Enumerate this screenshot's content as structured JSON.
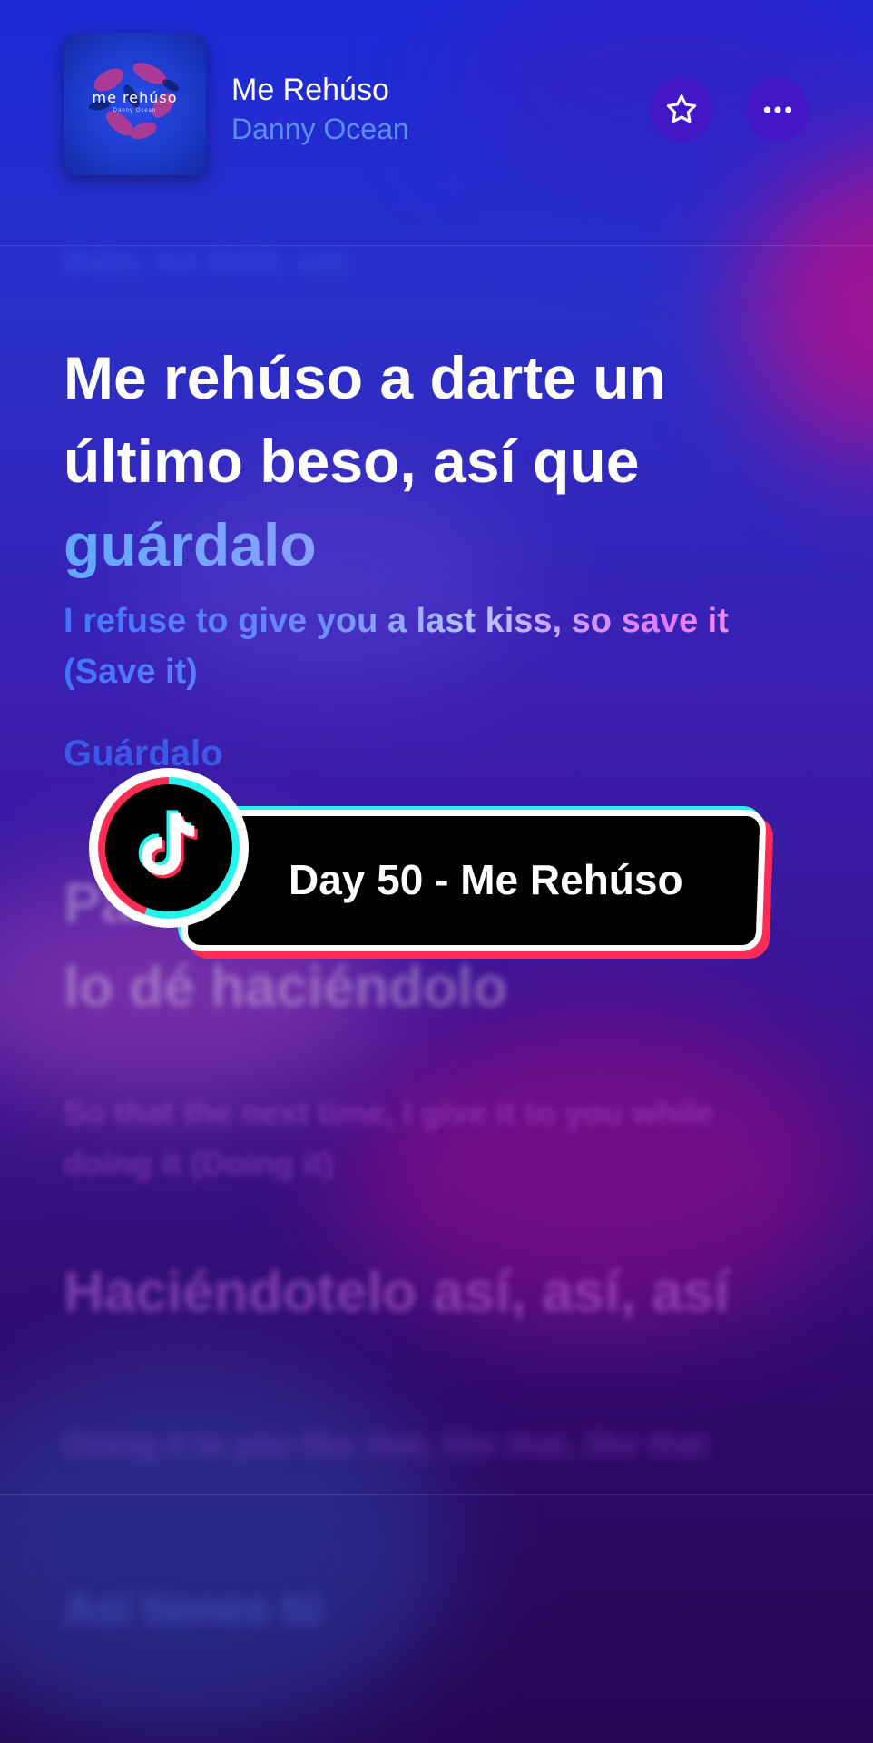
{
  "header": {
    "song_title": "Me Rehúso",
    "artist": "Danny Ocean",
    "album_art_title": "me rehúso",
    "album_art_subtitle": "Danny Ocean",
    "favorite_icon": "star-icon",
    "more_icon": "ellipsis-icon"
  },
  "lyrics": {
    "previous_line": "Baby, me dolió, ayy",
    "current_line_plain": "Me rehúso a darte un último beso, así que ",
    "current_line_highlight": "guárdalo",
    "current_translation": "I refuse to give you a last kiss, so save it (Save it)",
    "next_line": "Guárdalo",
    "next_lyric_1": "Para que la próxima vez te lo dé haciéndolo",
    "next_translation_1": "So that the next time, I give it to you while doing it (Doing it)",
    "next_lyric_2": "Haciéndotelo así, así, así",
    "next_translation_2": "Doing it to you like that, like that, like that",
    "last_visible_line": "Así tienes tú"
  },
  "overlay": {
    "tiktok_icon": "tiktok-logo-icon",
    "label": "Day 50 - Me Rehúso"
  },
  "colors": {
    "accent_blue": "#5b8ff0",
    "tiktok_cyan": "#25f4ee",
    "tiktok_red": "#fe2c55"
  }
}
